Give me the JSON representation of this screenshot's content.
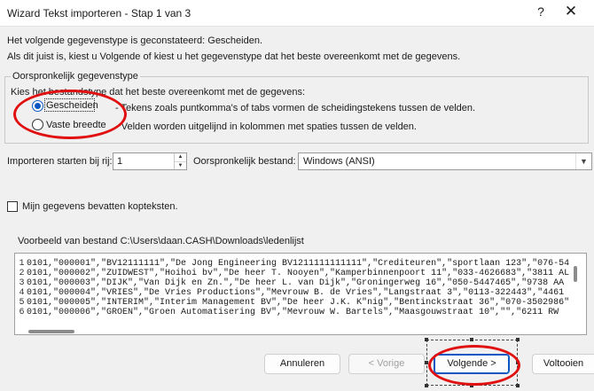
{
  "window": {
    "title": "Wizard Tekst importeren - Stap 1 van 3",
    "help": "?",
    "close": "✕"
  },
  "intro": {
    "detected": "Het volgende gegevenstype is geconstateerd: Gescheiden.",
    "instruction": "Als dit juist is, kiest u Volgende of kiest u het gegevenstype dat het beste overeenkomt met de gegevens."
  },
  "group": {
    "legend": "Oorspronkelijk gegevenstype",
    "prompt": "Kies het bestandstype dat het beste overeenkomt met de gegevens:",
    "options": [
      {
        "label": "Gescheiden",
        "desc": "- Tekens zoals puntkomma's of tabs vormen de scheidingstekens tussen de velden.",
        "selected": true
      },
      {
        "label": "Vaste breedte",
        "desc": "- Velden worden uitgelijnd in kolommen met spaties tussen de velden.",
        "selected": false
      }
    ]
  },
  "start_row": {
    "label": "Importeren starten bij rij:",
    "value": "1"
  },
  "origin": {
    "label": "Oorspronkelijk bestand:",
    "value": "Windows (ANSI)"
  },
  "headers_checkbox": {
    "label": "Mijn gegevens bevatten kopteksten.",
    "checked": false
  },
  "preview": {
    "label": "Voorbeeld van bestand C:\\Users\\daan.CASH\\Downloads\\ledenlijst",
    "rows": [
      {
        "num": "1",
        "text": "0101,\"000001\",\"BV12111111\",\"De Jong Engineering BV1211111111111\",\"Crediteuren\",\"sportlaan 123\",\"076-54"
      },
      {
        "num": "2",
        "text": "0101,\"000002\",\"ZUIDWEST\",\"Hoihoi bv\",\"De heer T. Nooyen\",\"Kamperbinnenpoort 11\",\"033-4626683\",\"3811 AL"
      },
      {
        "num": "3",
        "text": "0101,\"000003\",\"DIJK\",\"Van Dijk en Zn.\",\"De heer L. van Dijk\",\"Groningerweg 16\",\"050-5447465\",\"9738 AA"
      },
      {
        "num": "4",
        "text": "0101,\"000004\",\"VRIES\",\"De Vries Productions\",\"Mevrouw B. de Vries\",\"Langstraat 3\",\"0113-322443\",\"4461"
      },
      {
        "num": "5",
        "text": "0101,\"000005\",\"INTERIM\",\"Interim Management BV\",\"De heer J.K. K\"nig\",\"Bentinckstraat 36\",\"070-3502986\""
      },
      {
        "num": "6",
        "text": "0101,\"000006\",\"GROEN\",\"Groen Automatisering BV\",\"Mevrouw W. Bartels\",\"Maasgouwstraat 10\",\"\",\"6211 RW"
      }
    ]
  },
  "buttons": {
    "cancel": "Annuleren",
    "back": "< Vorige",
    "next": "Volgende >",
    "finish": "Voltooien"
  },
  "colors": {
    "annotation": "#e01010",
    "accent": "#0a57c4"
  }
}
